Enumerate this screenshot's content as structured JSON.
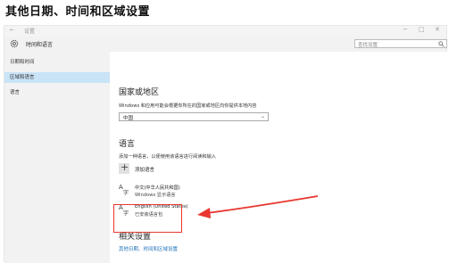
{
  "page_heading": "其他日期、时间和区域设置",
  "titlebar": {
    "back": "←",
    "title": "设置",
    "controls": [
      "−",
      "□",
      "✕"
    ]
  },
  "header": {
    "title": "时间和语言",
    "search_placeholder": "查找设置"
  },
  "sidebar": {
    "items": [
      {
        "label": "日期和时间",
        "active": false
      },
      {
        "label": "区域和语言",
        "active": true
      },
      {
        "label": "语言",
        "active": false
      }
    ]
  },
  "region": {
    "heading": "国家或地区",
    "description": "Windows 和应用可能会根据你所在的国家或地区向你提供本地内容",
    "selected": "中国"
  },
  "language": {
    "heading": "语言",
    "description": "添加一种语言，以便使用该语言进行阅读和输入",
    "add_label": "添加语言",
    "items": [
      {
        "name": "中文(中华人民共和国)",
        "sub": "Windows 显示语言"
      },
      {
        "name": "English (United States)",
        "sub": "已安装语言包"
      }
    ]
  },
  "related": {
    "heading": "相关设置",
    "link": "其他日期、时间和区域设置"
  },
  "colors": {
    "accent": "#1d6fb8",
    "annotation": "#e8362f",
    "sidebar_active": "#c9e3f7"
  }
}
